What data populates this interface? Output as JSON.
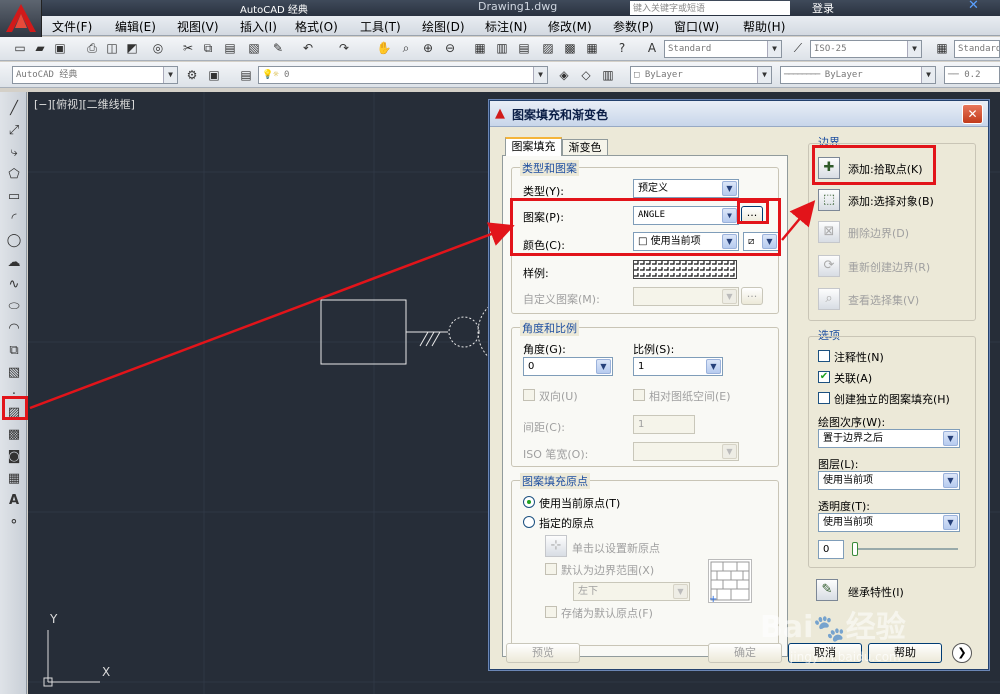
{
  "app": {
    "file_name": "Drawing1.dwg",
    "search_placeholder": "键入关键字或短语",
    "login": "登录",
    "workspace_title": "AutoCAD 经典"
  },
  "menu": [
    "文件(F)",
    "编辑(E)",
    "视图(V)",
    "插入(I)",
    "格式(O)",
    "工具(T)",
    "绘图(D)",
    "标注(N)",
    "修改(M)",
    "参数(P)",
    "窗口(W)",
    "帮助(H)"
  ],
  "toolbar": {
    "text_style": "Standard",
    "dim_style": "ISO-25",
    "table_style": "Standard",
    "workspace": "AutoCAD 经典",
    "layer": "0",
    "color": "ByLayer",
    "linetype": "ByLayer",
    "lineweight": "0.2"
  },
  "viewport": {
    "label": "[−][俯视][二维线框]",
    "ucs_y": "Y",
    "ucs_x": "X"
  },
  "dialog": {
    "title": "图案填充和渐变色",
    "tabs": [
      "图案填充",
      "渐变色"
    ],
    "type_group": {
      "title": "类型和图案",
      "type_label": "类型(Y):",
      "type_value": "预定义",
      "pattern_label": "图案(P):",
      "pattern_value": "ANGLE",
      "color_label": "颜色(C):",
      "color_value": "使用当前项",
      "sample_label": "样例:",
      "custom_label": "自定义图案(M):",
      "browse": "..."
    },
    "angle_group": {
      "title": "角度和比例",
      "angle_label": "角度(G):",
      "angle_value": "0",
      "scale_label": "比例(S):",
      "scale_value": "1",
      "double_label": "双向(U)",
      "relative_label": "相对图纸空间(E)",
      "spacing_label": "间距(C):",
      "spacing_value": "1",
      "iso_label": "ISO 笔宽(O):"
    },
    "origin_group": {
      "title": "图案填充原点",
      "use_current": "使用当前原点(T)",
      "specified": "指定的原点",
      "click_set": "单击以设置新原点",
      "default_boundary": "默认为边界范围(X)",
      "position": "左下",
      "store_default": "存储为默认原点(F)"
    },
    "boundary": {
      "title": "边界",
      "pick_points": "添加:拾取点(K)",
      "select_objects": "添加:选择对象(B)",
      "remove": "删除边界(D)",
      "recreate": "重新创建边界(R)",
      "view_selection": "查看选择集(V)"
    },
    "options": {
      "title": "选项",
      "annotative": "注释性(N)",
      "associative": "关联(A)",
      "associative_checked": true,
      "separate": "创建独立的图案填充(H)",
      "draw_order_label": "绘图次序(W):",
      "draw_order": "置于边界之后",
      "layer_label": "图层(L):",
      "layer": "使用当前项",
      "transparency_label": "透明度(T):",
      "transparency": "使用当前项",
      "transparency_value": "0"
    },
    "inherit": "继承特性(I)",
    "buttons": {
      "preview": "预览",
      "ok": "确定",
      "cancel": "取消",
      "help": "帮助"
    }
  },
  "watermark": {
    "brand": "Bai",
    "brand2": "经验",
    "url": "jingyan.baidu.com"
  },
  "colors": {
    "canvas": "#262d38",
    "highlight": "#e2141a",
    "accent": "#1e4fa0"
  }
}
